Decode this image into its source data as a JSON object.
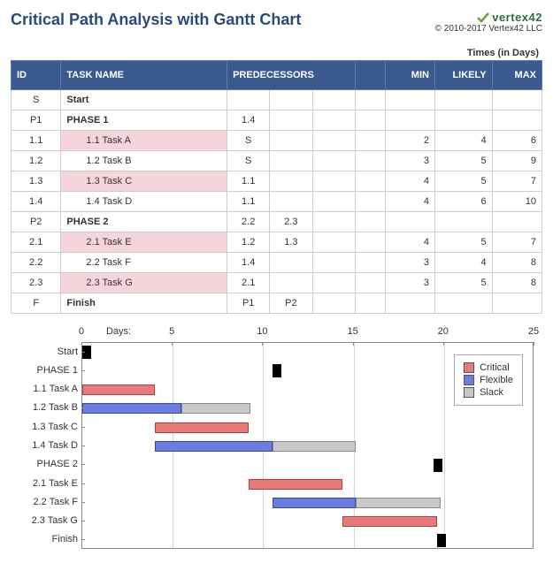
{
  "header": {
    "title": "Critical Path Analysis with Gantt Chart",
    "logo_text": "vertex42",
    "copyright": "© 2010-2017 Vertex42 LLC"
  },
  "table": {
    "times_label": "Times (in Days)",
    "cols": {
      "id": "ID",
      "name": "TASK NAME",
      "pred": "PREDECESSORS",
      "min": "MIN",
      "likely": "LIKELY",
      "max": "MAX"
    },
    "rows": [
      {
        "id": "S",
        "name": "Start",
        "bold": true,
        "indent": false,
        "crit": false,
        "preds": [
          "",
          "",
          ""
        ],
        "min": "",
        "likely": "",
        "max": ""
      },
      {
        "id": "P1",
        "name": "PHASE 1",
        "bold": true,
        "indent": false,
        "crit": false,
        "preds": [
          "1.4",
          "",
          ""
        ],
        "min": "",
        "likely": "",
        "max": ""
      },
      {
        "id": "1.1",
        "name": "1.1 Task A",
        "bold": false,
        "indent": true,
        "crit": true,
        "preds": [
          "S",
          "",
          ""
        ],
        "min": "2",
        "likely": "4",
        "max": "6"
      },
      {
        "id": "1.2",
        "name": "1.2 Task B",
        "bold": false,
        "indent": true,
        "crit": false,
        "preds": [
          "S",
          "",
          ""
        ],
        "min": "3",
        "likely": "5",
        "max": "9"
      },
      {
        "id": "1.3",
        "name": "1.3 Task C",
        "bold": false,
        "indent": true,
        "crit": true,
        "preds": [
          "1.1",
          "",
          ""
        ],
        "min": "4",
        "likely": "5",
        "max": "7"
      },
      {
        "id": "1.4",
        "name": "1.4 Task D",
        "bold": false,
        "indent": true,
        "crit": false,
        "preds": [
          "1.1",
          "",
          ""
        ],
        "min": "4",
        "likely": "6",
        "max": "10"
      },
      {
        "id": "P2",
        "name": "PHASE 2",
        "bold": true,
        "indent": false,
        "crit": false,
        "preds": [
          "2.2",
          "2.3",
          ""
        ],
        "min": "",
        "likely": "",
        "max": ""
      },
      {
        "id": "2.1",
        "name": "2.1 Task E",
        "bold": false,
        "indent": true,
        "crit": true,
        "preds": [
          "1.2",
          "1.3",
          ""
        ],
        "min": "4",
        "likely": "5",
        "max": "7"
      },
      {
        "id": "2.2",
        "name": "2.2 Task F",
        "bold": false,
        "indent": true,
        "crit": false,
        "preds": [
          "1.4",
          "",
          ""
        ],
        "min": "3",
        "likely": "4",
        "max": "8"
      },
      {
        "id": "2.3",
        "name": "2.3 Task G",
        "bold": false,
        "indent": true,
        "crit": true,
        "preds": [
          "2.1",
          "",
          ""
        ],
        "min": "3",
        "likely": "5",
        "max": "8"
      },
      {
        "id": "F",
        "name": "Finish",
        "bold": true,
        "indent": false,
        "crit": false,
        "preds": [
          "P1",
          "P2",
          ""
        ],
        "min": "",
        "likely": "",
        "max": ""
      }
    ]
  },
  "chart_data": {
    "type": "bar",
    "orientation": "horizontal",
    "xlabel": "Days:",
    "x_ticks": [
      0,
      5,
      10,
      15,
      20,
      25
    ],
    "xlim": [
      0,
      25
    ],
    "legend": [
      {
        "name": "Critical",
        "color": "#e87a7a"
      },
      {
        "name": "Flexible",
        "color": "#6a7ee0"
      },
      {
        "name": "Slack",
        "color": "#c8c8c8"
      }
    ],
    "rows": [
      {
        "label": "Start",
        "bars": [
          {
            "type": "milestone",
            "start": 0,
            "dur": 0.5
          }
        ]
      },
      {
        "label": "PHASE 1",
        "bars": [
          {
            "type": "milestone",
            "start": 10.5,
            "dur": 0.5
          }
        ]
      },
      {
        "label": "1.1 Task A",
        "bars": [
          {
            "type": "critical",
            "start": 0,
            "dur": 4
          }
        ]
      },
      {
        "label": "1.2 Task B",
        "bars": [
          {
            "type": "flexible",
            "start": 0,
            "dur": 5.5
          },
          {
            "type": "slack",
            "start": 5.5,
            "dur": 3.8
          }
        ]
      },
      {
        "label": "1.3 Task C",
        "bars": [
          {
            "type": "critical",
            "start": 4,
            "dur": 5.2
          }
        ]
      },
      {
        "label": "1.4 Task D",
        "bars": [
          {
            "type": "flexible",
            "start": 4,
            "dur": 6.5
          },
          {
            "type": "slack",
            "start": 10.5,
            "dur": 4.6
          }
        ]
      },
      {
        "label": "PHASE 2",
        "bars": [
          {
            "type": "milestone",
            "start": 19.4,
            "dur": 0.5
          }
        ]
      },
      {
        "label": "2.1 Task E",
        "bars": [
          {
            "type": "critical",
            "start": 9.2,
            "dur": 5.2
          }
        ]
      },
      {
        "label": "2.2 Task F",
        "bars": [
          {
            "type": "flexible",
            "start": 10.5,
            "dur": 4.6
          },
          {
            "type": "slack",
            "start": 15.1,
            "dur": 4.7
          }
        ]
      },
      {
        "label": "2.3 Task G",
        "bars": [
          {
            "type": "critical",
            "start": 14.4,
            "dur": 5.2
          }
        ]
      },
      {
        "label": "Finish",
        "bars": [
          {
            "type": "milestone",
            "start": 19.6,
            "dur": 0.5
          }
        ]
      }
    ]
  }
}
